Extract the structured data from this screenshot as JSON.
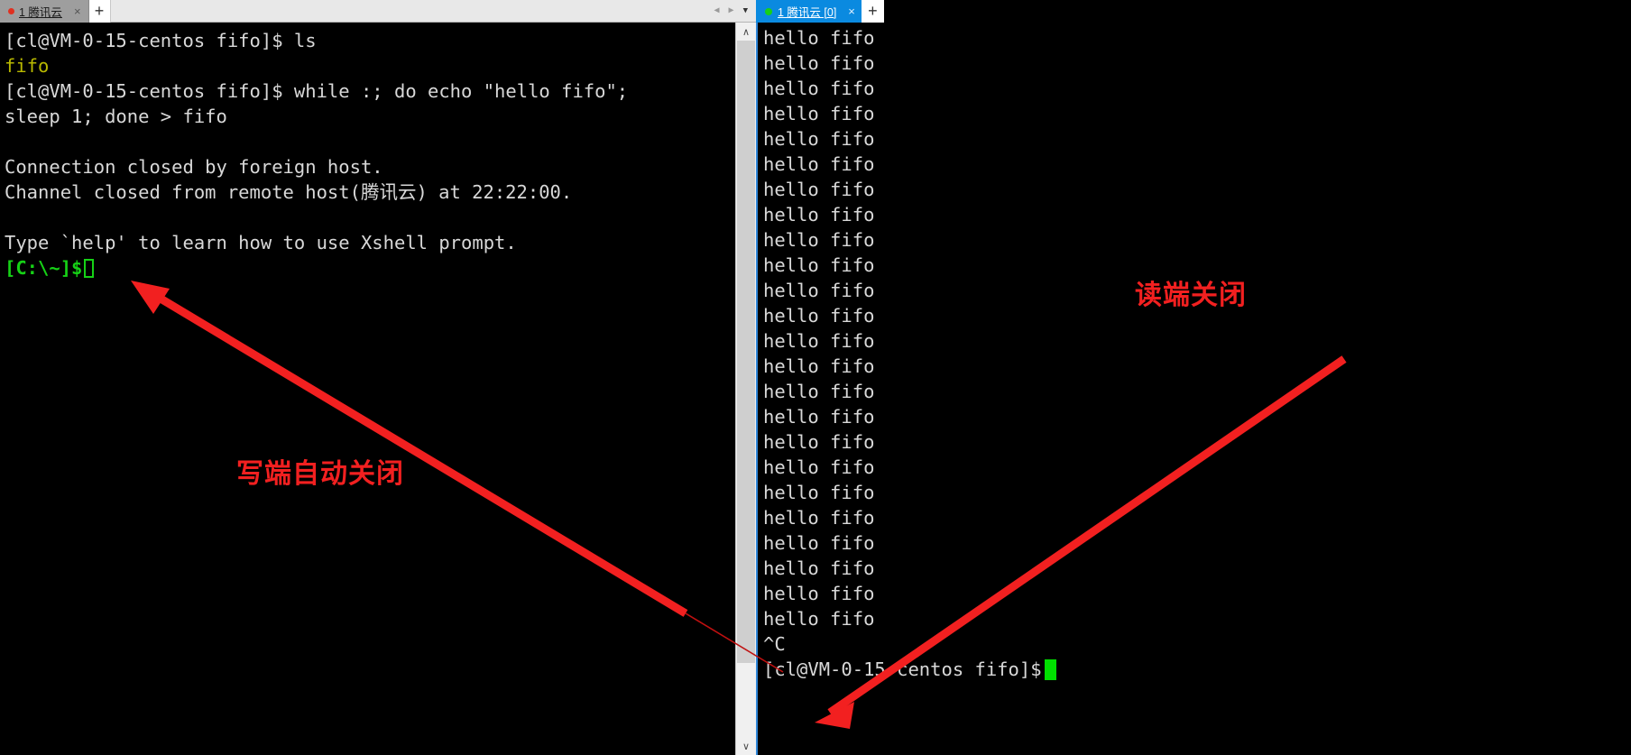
{
  "left_window": {
    "tab": {
      "label": "1 腾讯云",
      "close_label": "×",
      "status_dot_color": "#e03020"
    },
    "new_tab_label": "+",
    "nav_prev": "◀",
    "nav_next": "▶",
    "nav_menu": "▼",
    "terminal_lines": [
      {
        "text": "[cl@VM-0-15-centos fifo]$ ls",
        "color": "default"
      },
      {
        "text": "fifo",
        "color": "yellow"
      },
      {
        "text": "[cl@VM-0-15-centos fifo]$ while :; do echo \"hello fifo\";",
        "color": "default"
      },
      {
        "text": "sleep 1; done > fifo",
        "color": "default"
      },
      {
        "text": "",
        "color": "default"
      },
      {
        "text": "Connection closed by foreign host.",
        "color": "default"
      },
      {
        "text": "Channel closed from remote host(腾讯云) at 22:22:00.",
        "color": "default"
      },
      {
        "text": "",
        "color": "default"
      },
      {
        "text": "Type `help' to learn how to use Xshell prompt.",
        "color": "default"
      }
    ],
    "prompt": "[C:\\~]$",
    "scrollbar": {
      "up_arrow": "∧",
      "down_arrow": "∨"
    }
  },
  "right_window": {
    "tab": {
      "label": "1 腾讯云 [0]",
      "close_label": "×",
      "status_dot_color": "#18d018"
    },
    "new_tab_label": "+",
    "terminal_lines": [
      "hello fifo",
      "hello fifo",
      "hello fifo",
      "hello fifo",
      "hello fifo",
      "hello fifo",
      "hello fifo",
      "hello fifo",
      "hello fifo",
      "hello fifo",
      "hello fifo",
      "hello fifo",
      "hello fifo",
      "hello fifo",
      "hello fifo",
      "hello fifo",
      "hello fifo",
      "hello fifo",
      "hello fifo",
      "hello fifo",
      "hello fifo",
      "hello fifo",
      "hello fifo",
      "hello fifo",
      "^C"
    ],
    "prompt": "[cl@VM-0-15-centos fifo]$"
  },
  "annotations": {
    "left_label": "写端自动关闭",
    "right_label": "读端关闭",
    "color": "#f22020"
  }
}
